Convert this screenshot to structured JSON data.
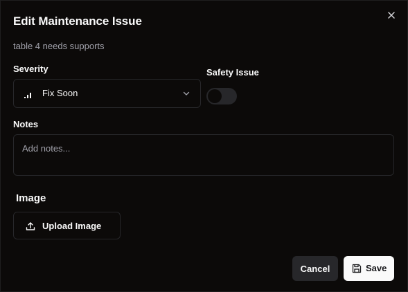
{
  "dialog": {
    "title": "Edit Maintenance Issue",
    "subtitle": "table 4 needs supports",
    "close_icon": "close-icon"
  },
  "severity": {
    "label": "Severity",
    "value": "Fix Soon",
    "icon": "signal-bars-icon",
    "chevron_icon": "chevron-down-icon"
  },
  "safety": {
    "label": "Safety Issue",
    "enabled": false
  },
  "notes": {
    "label": "Notes",
    "placeholder": "Add notes...",
    "value": ""
  },
  "image": {
    "heading": "Image",
    "upload_label": "Upload Image",
    "upload_icon": "upload-icon"
  },
  "actions": {
    "cancel_label": "Cancel",
    "save_label": "Save",
    "save_icon": "save-icon"
  },
  "colors": {
    "background": "#0c0a09",
    "border": "#27272a",
    "muted_text": "#a1a1aa",
    "primary_text": "#fafafa",
    "save_button_bg": "#fafafa"
  }
}
